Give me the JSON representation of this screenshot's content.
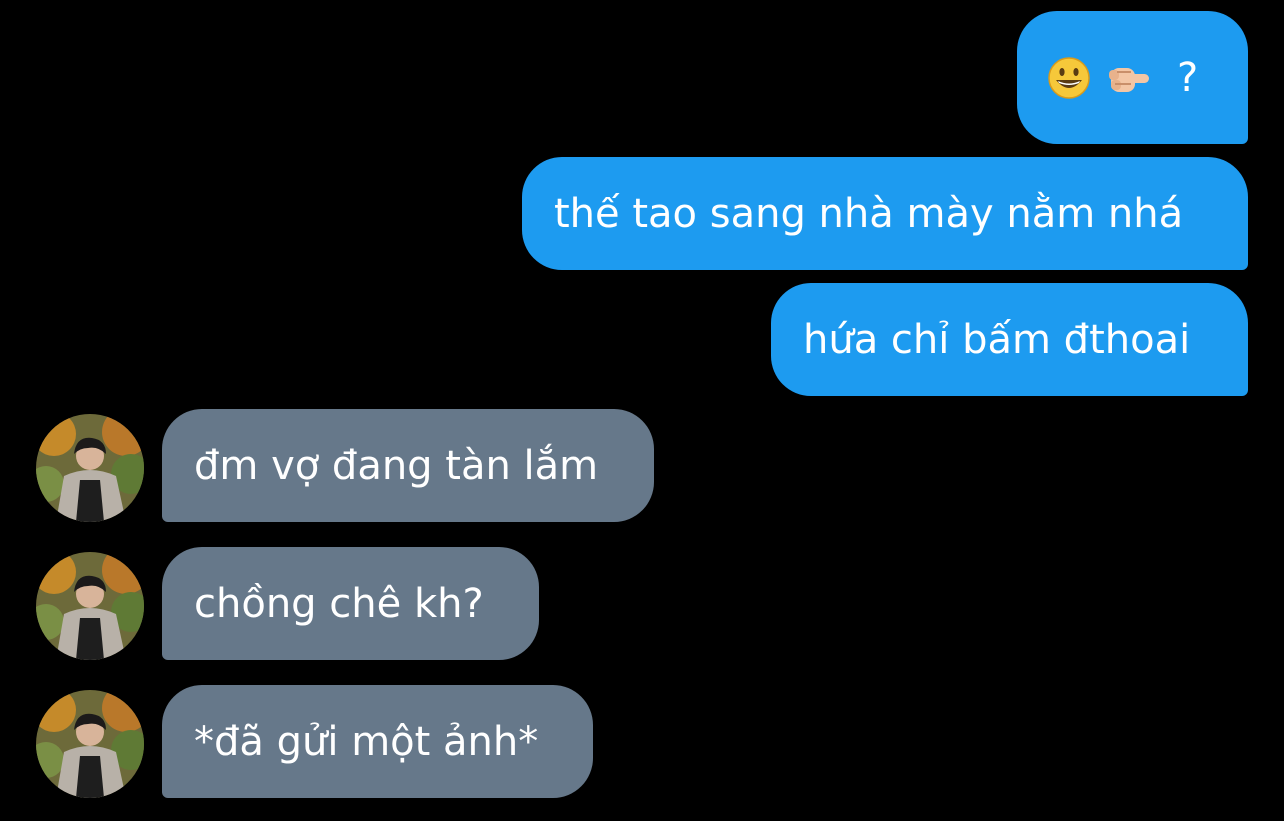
{
  "conversation": {
    "sent": [
      {
        "id": "m1",
        "text": "?",
        "emojis": [
          "grinning-face-emoji",
          "backhand-pointing-emoji"
        ]
      },
      {
        "id": "m2",
        "text": "thế tao sang nhà mày nằm nhá"
      },
      {
        "id": "m3",
        "text": "hứa chỉ bấm đthoai"
      }
    ],
    "received": [
      {
        "id": "m4",
        "text": "đm vợ đang tàn lắm"
      },
      {
        "id": "m5",
        "text": "chồng chê kh?"
      },
      {
        "id": "m6",
        "text": "*đã gửi một ảnh*"
      }
    ]
  },
  "colors": {
    "background": "#000000",
    "sent_bubble": "#1d9bf0",
    "received_bubble": "#66788a",
    "text": "#ffffff"
  }
}
